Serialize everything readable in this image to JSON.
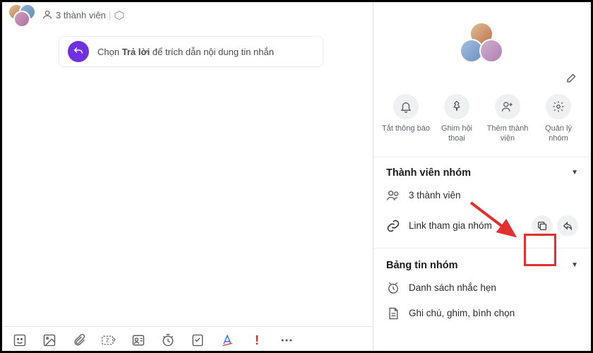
{
  "header": {
    "member_count_text": "3 thành viên"
  },
  "hint": {
    "text_prefix": "Chọn",
    "text_bold": "Trả lời",
    "text_suffix": "để trích dẫn nội dung tin nhắn"
  },
  "actions": {
    "mute": "Tắt thông báo",
    "pin": "Ghim hội thoại",
    "add_member": "Thêm thành viên",
    "manage": "Quản lý nhóm"
  },
  "sections": {
    "members_title": "Thành viên nhóm",
    "members_count": "3 thành viên",
    "join_link": "Link tham gia nhóm",
    "board_title": "Bảng tin nhóm",
    "reminders": "Danh sách nhắc hẹn",
    "notes": "Ghi chú, ghim, bình chọn"
  }
}
